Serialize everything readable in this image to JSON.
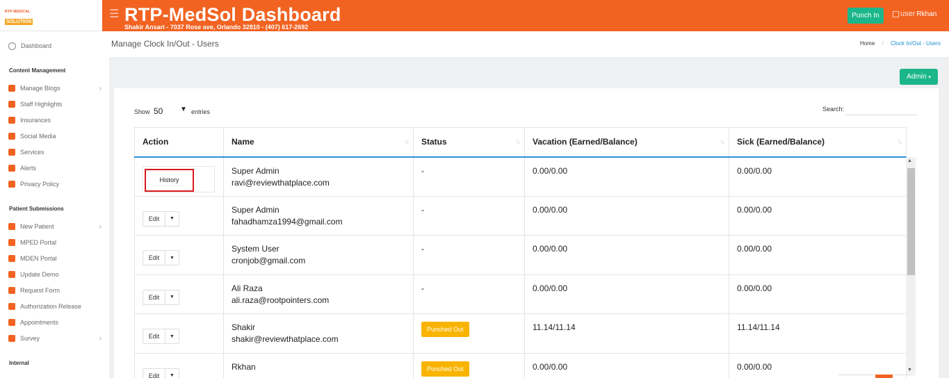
{
  "brand": {
    "logo_line1": "RTP MEDICAL",
    "logo_line2": "SOLUTION"
  },
  "header": {
    "menu_icon": "hamburger-icon",
    "title": "RTP-MedSol Dashboard",
    "subtitle": "Shakir Ansari - 7037 Rose ave, Orlando 32810 - (407) 617-2692",
    "punch_in": "Punch In",
    "user_img_alt": "user",
    "user_name": "Rkhan"
  },
  "sidebar": {
    "dashboard": "Dashboard",
    "section_content": "Content Management",
    "content_items": [
      {
        "label": "Manage Blogs",
        "icon": "blog-icon",
        "chevron": true
      },
      {
        "label": "Staff Highlights",
        "icon": "staff-icon"
      },
      {
        "label": "Insurances",
        "icon": "building-icon"
      },
      {
        "label": "Social Media",
        "icon": "social-icon"
      },
      {
        "label": "Services",
        "icon": "services-icon"
      },
      {
        "label": "Alerts",
        "icon": "phone-icon"
      },
      {
        "label": "Privacy Policy",
        "icon": "shield-icon"
      }
    ],
    "section_patient": "Patient Submissions",
    "patient_items": [
      {
        "label": "New Patient",
        "icon": "home-icon",
        "chevron": true
      },
      {
        "label": "MPED Portal",
        "icon": "home-icon"
      },
      {
        "label": "MDEN Portal",
        "icon": "home-icon"
      },
      {
        "label": "Update Demo",
        "icon": "card-icon"
      },
      {
        "label": "Request Form",
        "icon": "file-icon"
      },
      {
        "label": "Authorization Release",
        "icon": "check-icon"
      },
      {
        "label": "Appointments",
        "icon": "calendar-icon"
      },
      {
        "label": "Survey",
        "icon": "chart-icon",
        "chevron": true
      }
    ],
    "section_internal": "Internal"
  },
  "page": {
    "title": "Manage Clock In/Out - Users",
    "breadcrumb_home": "Home",
    "breadcrumb_sep": "/",
    "breadcrumb_current": "Clock In/Out - Users",
    "admin_button": "Admin"
  },
  "table_controls": {
    "show": "Show",
    "show_value": "50",
    "entries": "entries",
    "search": "Search:",
    "search_value": ""
  },
  "table": {
    "columns": [
      "Action",
      "Name",
      "Status",
      "Vacation (Earned/Balance)",
      "Sick (Earned/Balance)"
    ],
    "rows": [
      {
        "action": "History",
        "name": "Super Admin",
        "email": "ravi@reviewthatplace.com",
        "status": "-",
        "vacation": "0.00/0.00",
        "sick": "0.00/0.00"
      },
      {
        "action": "Edit",
        "name": "Super Admin",
        "email": "fahadhamza1994@gmail.com",
        "status": "-",
        "vacation": "0.00/0.00",
        "sick": "0.00/0.00"
      },
      {
        "action": "Edit",
        "name": "System User",
        "email": "cronjob@gmail.com",
        "status": "-",
        "vacation": "0.00/0.00",
        "sick": "0.00/0.00"
      },
      {
        "action": "Edit",
        "name": "Ali Raza",
        "email": "ali.raza@rootpointers.com",
        "status": "-",
        "vacation": "0.00/0.00",
        "sick": "0.00/0.00"
      },
      {
        "action": "Edit",
        "name": "Shakir",
        "email": "shakir@reviewthatplace.com",
        "status": "Punched Out",
        "vacation": "11.14/11.14",
        "sick": "11.14/11.14"
      },
      {
        "action": "Edit",
        "name": "Rkhan",
        "email": "",
        "status": "Punched Out",
        "vacation": "0.00/0.00",
        "sick": "0.00/0.00"
      }
    ]
  },
  "colors": {
    "brand_orange": "#f26322",
    "green": "#1bb68a",
    "badge": "#f8b400",
    "accent_blue": "#2a8fd6"
  }
}
